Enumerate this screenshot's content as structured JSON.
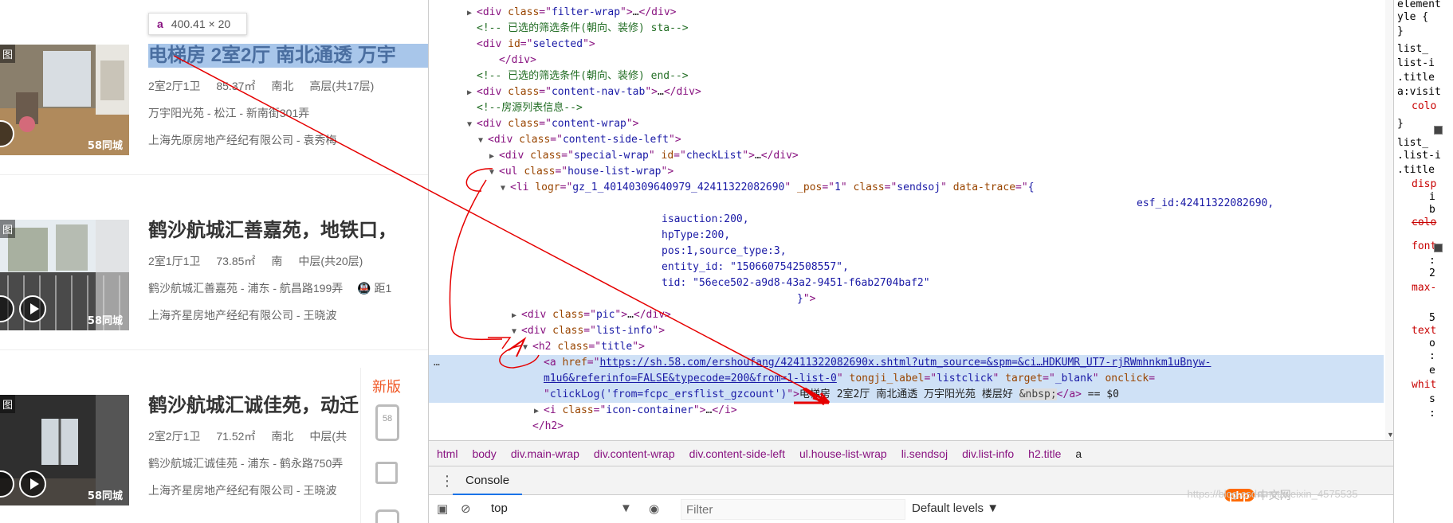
{
  "tooltip": {
    "tag": "a",
    "size": "400.41 × 20"
  },
  "listings": [
    {
      "badge": "图",
      "watermark": "58同城",
      "title": "电梯房 2室2厅 南北通透 万宇",
      "specs": [
        "2室2厅1卫",
        "85.37㎡",
        "南北",
        "高层(共17层)"
      ],
      "location": "万宇阳光苑 - 松江 - 新南街301弄",
      "agent": "上海先原房地产经纪有限公司 - 袁秀梅"
    },
    {
      "badge": "图",
      "watermark": "58同城",
      "title": "鹤沙航城汇善嘉苑，地铁口，",
      "specs": [
        "2室1厅1卫",
        "73.85㎡",
        "南",
        "中层(共20层)"
      ],
      "location": "鹤沙航城汇善嘉苑 - 浦东 - 航昌路199弄",
      "extra": "距1",
      "agent": "上海齐星房地产经纪有限公司 - 王晓波"
    },
    {
      "badge": "图",
      "watermark": "58同城",
      "title": "鹤沙航城汇诚佳苑，动迁",
      "specs": [
        "2室2厅1卫",
        "71.52㎡",
        "南北",
        "中层(共"
      ],
      "location": "鹤沙航城汇诚佳苑 - 浦东 - 鹤永路750弄",
      "agent": "上海齐星房地产经纪有限公司 - 王晓波"
    }
  ],
  "side_widget": {
    "label": "新版",
    "phone_text": "58"
  },
  "elements": [
    {
      "depth": 0,
      "tri": "▶",
      "parts": [
        [
          "tag",
          "<div "
        ],
        [
          "an",
          "class"
        ],
        [
          "tag",
          "=\""
        ],
        [
          "av",
          "filter-wrap"
        ],
        [
          "tag",
          "\">"
        ],
        [
          "tx",
          "…"
        ],
        [
          "tag",
          "</div>"
        ]
      ]
    },
    {
      "depth": 0,
      "tri": "",
      "parts": [
        [
          "cm",
          "<!-- 已选的筛选条件(朝向、装修) sta-->"
        ]
      ]
    },
    {
      "depth": 0,
      "tri": "",
      "parts": [
        [
          "tag",
          "<div "
        ],
        [
          "an",
          "id"
        ],
        [
          "tag",
          "=\""
        ],
        [
          "av",
          "selected"
        ],
        [
          "tag",
          "\">"
        ]
      ]
    },
    {
      "depth": 2,
      "tri": "",
      "parts": [
        [
          "tag",
          "</div>"
        ]
      ]
    },
    {
      "depth": 0,
      "tri": "",
      "parts": [
        [
          "cm",
          "<!-- 已选的筛选条件(朝向、装修) end-->"
        ]
      ]
    },
    {
      "depth": 0,
      "tri": "▶",
      "parts": [
        [
          "tag",
          "<div "
        ],
        [
          "an",
          "class"
        ],
        [
          "tag",
          "=\""
        ],
        [
          "av",
          "content-nav-tab"
        ],
        [
          "tag",
          "\">"
        ],
        [
          "tx",
          "…"
        ],
        [
          "tag",
          "</div>"
        ]
      ]
    },
    {
      "depth": 0,
      "tri": "",
      "parts": [
        [
          "cm",
          "<!--房源列表信息-->"
        ]
      ]
    },
    {
      "depth": 0,
      "tri": "▼",
      "parts": [
        [
          "tag",
          "<div "
        ],
        [
          "an",
          "class"
        ],
        [
          "tag",
          "=\""
        ],
        [
          "av",
          "content-wrap"
        ],
        [
          "tag",
          "\">"
        ]
      ]
    },
    {
      "depth": 1,
      "tri": "▼",
      "parts": [
        [
          "tag",
          "<div "
        ],
        [
          "an",
          "class"
        ],
        [
          "tag",
          "=\""
        ],
        [
          "av",
          "content-side-left"
        ],
        [
          "tag",
          "\">"
        ]
      ]
    },
    {
      "depth": 2,
      "tri": "▶",
      "parts": [
        [
          "tag",
          "<div "
        ],
        [
          "an",
          "class"
        ],
        [
          "tag",
          "=\""
        ],
        [
          "av",
          "special-wrap"
        ],
        [
          "tag",
          "\" "
        ],
        [
          "an",
          "id"
        ],
        [
          "tag",
          "=\""
        ],
        [
          "av",
          "checkList"
        ],
        [
          "tag",
          "\">"
        ],
        [
          "tx",
          "…"
        ],
        [
          "tag",
          "</div>"
        ]
      ]
    },
    {
      "depth": 2,
      "tri": "▼",
      "parts": [
        [
          "tag",
          "<ul "
        ],
        [
          "an",
          "class"
        ],
        [
          "tag",
          "=\""
        ],
        [
          "av",
          "house-list-wrap"
        ],
        [
          "tag",
          "\">"
        ]
      ]
    },
    {
      "depth": 3,
      "tri": "▼",
      "parts": [
        [
          "tag",
          "<li "
        ],
        [
          "an",
          "logr"
        ],
        [
          "tag",
          "=\""
        ],
        [
          "av",
          "gz_1_40140309640979_42411322082690"
        ],
        [
          "tag",
          "\" "
        ],
        [
          "an",
          "_pos"
        ],
        [
          "tag",
          "=\""
        ],
        [
          "av",
          "1"
        ],
        [
          "tag",
          "\" "
        ],
        [
          "an",
          "class"
        ],
        [
          "tag",
          "=\""
        ],
        [
          "av",
          "sendsoj"
        ],
        [
          "tag",
          "\" "
        ],
        [
          "an",
          "data-trace"
        ],
        [
          "tag",
          "=\""
        ],
        [
          "av",
          "{"
        ]
      ]
    },
    {
      "depth": 0,
      "tri": "",
      "indent": 876,
      "parts": [
        [
          "av",
          "esf_id:42411322082690,"
        ]
      ]
    },
    {
      "depth": 0,
      "tri": "",
      "indent": 280,
      "parts": [
        [
          "av",
          "isauction:200,"
        ]
      ]
    },
    {
      "depth": 0,
      "tri": "",
      "indent": 280,
      "parts": [
        [
          "av",
          "hpType:200,"
        ]
      ]
    },
    {
      "depth": 0,
      "tri": "",
      "indent": 280,
      "parts": [
        [
          "av",
          "pos:1,source_type:3,"
        ]
      ]
    },
    {
      "depth": 0,
      "tri": "",
      "indent": 280,
      "parts": [
        [
          "av",
          "entity_id: \"1506607542508557\","
        ]
      ]
    },
    {
      "depth": 0,
      "tri": "",
      "indent": 280,
      "parts": [
        [
          "av",
          "tid: \"56ece502-a9d8-43a2-9451-f6ab2704baf2\""
        ]
      ]
    },
    {
      "depth": 0,
      "tri": "",
      "indent": 450,
      "parts": [
        [
          "av",
          "}"
        ],
        [
          "tag",
          "\">"
        ]
      ]
    },
    {
      "depth": 4,
      "tri": "▶",
      "parts": [
        [
          "tag",
          "<div "
        ],
        [
          "an",
          "class"
        ],
        [
          "tag",
          "=\""
        ],
        [
          "av",
          "pic"
        ],
        [
          "tag",
          "\">"
        ],
        [
          "tx",
          "…"
        ],
        [
          "tag",
          "</div>"
        ]
      ]
    },
    {
      "depth": 4,
      "tri": "▼",
      "parts": [
        [
          "tag",
          "<div "
        ],
        [
          "an",
          "class"
        ],
        [
          "tag",
          "=\""
        ],
        [
          "av",
          "list-info"
        ],
        [
          "tag",
          "\">"
        ]
      ]
    },
    {
      "depth": 5,
      "tri": "▼",
      "parts": [
        [
          "tag",
          "<h2 "
        ],
        [
          "an",
          "class"
        ],
        [
          "tag",
          "=\""
        ],
        [
          "av",
          "title"
        ],
        [
          "tag",
          "\">"
        ]
      ]
    },
    {
      "depth": 6,
      "tri": "",
      "hl": true,
      "dots": "…",
      "parts": [
        [
          "tag",
          "<a "
        ],
        [
          "an",
          "href"
        ],
        [
          "tag",
          "=\""
        ],
        [
          "lk",
          "https://sh.58.com/ershoufang/42411322082690x.shtml?utm_source=&spm=&ci…HDKUMR_UT7-rjRWmhnkm1uBnyw-"
        ]
      ]
    },
    {
      "depth": 0,
      "tri": "",
      "hl": true,
      "indent": 132,
      "parts": [
        [
          "lk",
          "m1u6&referinfo=FALSE&typecode=200&from=1-list-0"
        ],
        [
          "tag",
          "\" "
        ],
        [
          "an",
          "tongji_label"
        ],
        [
          "tag",
          "=\""
        ],
        [
          "av",
          "listclick"
        ],
        [
          "tag",
          "\" "
        ],
        [
          "an",
          "target"
        ],
        [
          "tag",
          "=\""
        ],
        [
          "av",
          "_blank"
        ],
        [
          "tag",
          "\" "
        ],
        [
          "an",
          "onclick"
        ],
        [
          "tag",
          "="
        ]
      ]
    },
    {
      "depth": 0,
      "tri": "",
      "hl": true,
      "indent": 132,
      "parts": [
        [
          "tag",
          "\""
        ],
        [
          "av",
          "clickLog('from=fcpc_ersflist_gzcount')"
        ],
        [
          "tag",
          "\">"
        ],
        [
          "tx",
          "电梯房 2室2厅 南北通透 万宇阳光苑 楼层好 "
        ],
        [
          "nb",
          "&nbsp;"
        ],
        [
          "tag",
          "</a>"
        ],
        [
          "tx",
          " == $0"
        ]
      ]
    },
    {
      "depth": 6,
      "tri": "▶",
      "parts": [
        [
          "tag",
          "<i "
        ],
        [
          "an",
          "class"
        ],
        [
          "tag",
          "=\""
        ],
        [
          "av",
          "icon-container"
        ],
        [
          "tag",
          "\">"
        ],
        [
          "tx",
          "…"
        ],
        [
          "tag",
          "</i>"
        ]
      ]
    },
    {
      "depth": 5,
      "tri": "",
      "parts": [
        [
          "tag",
          "</h2>"
        ]
      ]
    }
  ],
  "styles_panel": [
    "element",
    "yle {",
    "}",
    "list_",
    "list-i",
    ".title",
    "a:visit",
    "colo",
    "}",
    "list_",
    ".list-i",
    ".title",
    "disp",
    "i",
    "b",
    "colo",
    "",
    "font",
    ":",
    "2",
    "max-",
    "",
    "5",
    "text",
    "o",
    ":",
    "e",
    "whit",
    "s",
    ":"
  ],
  "breadcrumbs": [
    "html",
    "body",
    "div.main-wrap",
    "div.content-wrap",
    "div.content-side-left",
    "ul.house-list-wrap",
    "li.sendsoj",
    "div.list-info",
    "h2.title",
    "a"
  ],
  "console": {
    "menu_icon": "⋮",
    "tab_label": "Console",
    "context": "top",
    "filter_placeholder": "Filter",
    "levels": "Default levels ▼"
  },
  "watermark": {
    "logo": "php",
    "text": "中文网",
    "url": "https://blog.csdn.net/weixin_4575535"
  }
}
